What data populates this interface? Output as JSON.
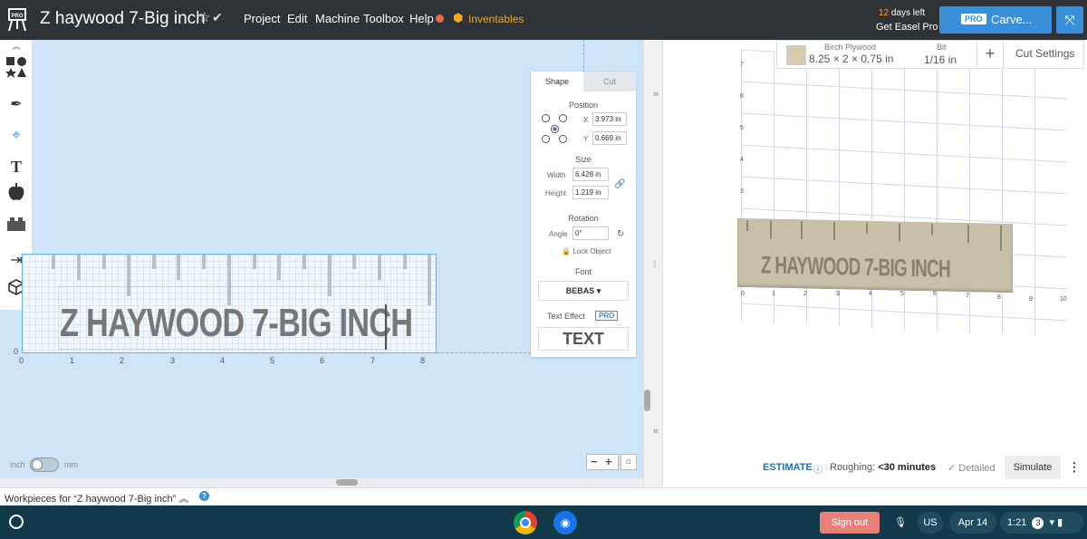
{
  "app": {
    "doc_title": "Z haywood 7-Big inch",
    "menu": [
      "Project",
      "Edit",
      "Machine",
      "Toolbox",
      "Help"
    ],
    "inventables_label": "Inventables",
    "trial_days_num": "12",
    "trial_days_rest": " days left",
    "trial_cta": "Get Easel Pro",
    "pro_badge": "PRO",
    "carve_label": "Carve..."
  },
  "canvas": {
    "design_text": "Z HAYWOOD 7-BIG INCH",
    "x_ticks": [
      "0",
      "1",
      "2",
      "3",
      "4",
      "5",
      "6",
      "7",
      "8"
    ],
    "y_zero": "0",
    "units": {
      "inch": "inch",
      "mm": "mm"
    },
    "zoom_minus": "−",
    "zoom_plus": "+"
  },
  "shape_panel": {
    "tabs": [
      "Shape",
      "Cut"
    ],
    "position_label": "Position",
    "x_label": "X",
    "x_value": "3.973 in",
    "y_label": "Y",
    "y_value": "0.669 in",
    "size_label": "Size",
    "width_label": "Width",
    "width_value": "6.428 in",
    "height_label": "Height",
    "height_value": "1.219 in",
    "rotation_label": "Rotation",
    "angle_label": "Angle",
    "angle_value": "0°",
    "lock_label": "Lock Object",
    "font_label": "Font",
    "font_value": "BEBAS",
    "effect_label": "Text Effect",
    "effect_pro": "PRO",
    "effect_preview": "TEXT"
  },
  "preview": {
    "material_name": "Birch Plywood",
    "material_dims": "8.25 × 2 × 0.75 in",
    "bit_label": "Bit",
    "bit_size": "1/16 in",
    "cut_settings": "Cut Settings",
    "y_ticks": [
      "7",
      "6",
      "5",
      "4",
      "3"
    ],
    "x_ticks": [
      "0",
      "1",
      "2",
      "3",
      "4",
      "5",
      "6",
      "7",
      "8",
      "9",
      "10"
    ],
    "board_text": "Z HAYWOOD 7-BIG INCH",
    "estimate_label": "ESTIMATE",
    "roughing_label": "Roughing:",
    "roughing_value": "<30 minutes",
    "detailed_label": "Detailed",
    "simulate_label": "Simulate"
  },
  "workpieces": {
    "label": "Workpieces for “Z haywood 7-Big inch”"
  },
  "shelf": {
    "signout_label": "Sign out",
    "keyboard_layout": "US",
    "date": "Apr 14",
    "time": "1:21",
    "notification_count": "3"
  }
}
